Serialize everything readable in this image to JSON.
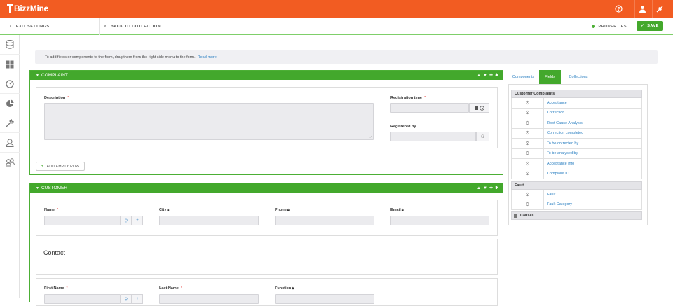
{
  "app": {
    "name": "BizzMine"
  },
  "topbar": {
    "icons": [
      "help-icon",
      "user-icon",
      "plug-icon"
    ]
  },
  "toolbar": {
    "exit_label": "EXIT SETTINGS",
    "back_label": "BACK TO COLLECTION",
    "properties_label": "PROPERTIES",
    "save_label": "SAVE"
  },
  "sidebar": {
    "items": [
      "database-icon",
      "grid-icon",
      "dashboard-icon",
      "pie-chart-icon",
      "tools-icon",
      "user-icon",
      "users-icon"
    ]
  },
  "info": {
    "text": "To add fields or components to the form, drag them from the right side menu to the form.",
    "link": "Read more"
  },
  "complaint": {
    "title": "COMPLAINT",
    "description_label": "Description",
    "registration_time_label": "Registration time",
    "registered_by_label": "Registered by",
    "add_row_label": "ADD EMPTY ROW"
  },
  "customer": {
    "title": "CUSTOMER",
    "name_label": "Name",
    "city_label": "City",
    "phone_label": "Phone",
    "email_label": "Email",
    "contact_title": "Contact",
    "first_name_label": "First Name",
    "last_name_label": "Last Name",
    "function_label": "Function"
  },
  "panel": {
    "tabs": [
      "Components",
      "Fields",
      "Collections"
    ],
    "active_tab": "Fields",
    "groups": [
      {
        "name": "Customer Complaints",
        "fields": [
          "Acceptance",
          "Correction",
          "Root Cause Analysis",
          "Correction completed",
          "To be corrected by",
          "To be analysed by",
          "Acceptance info",
          "Complaint ID"
        ]
      },
      {
        "name": "Fault",
        "fields": [
          "Fault",
          "Fault Category"
        ]
      },
      {
        "name": "Causes",
        "fields": []
      }
    ]
  },
  "colors": {
    "brand": "#f25c22",
    "accent": "#43a82c",
    "link": "#2a7fc1"
  }
}
